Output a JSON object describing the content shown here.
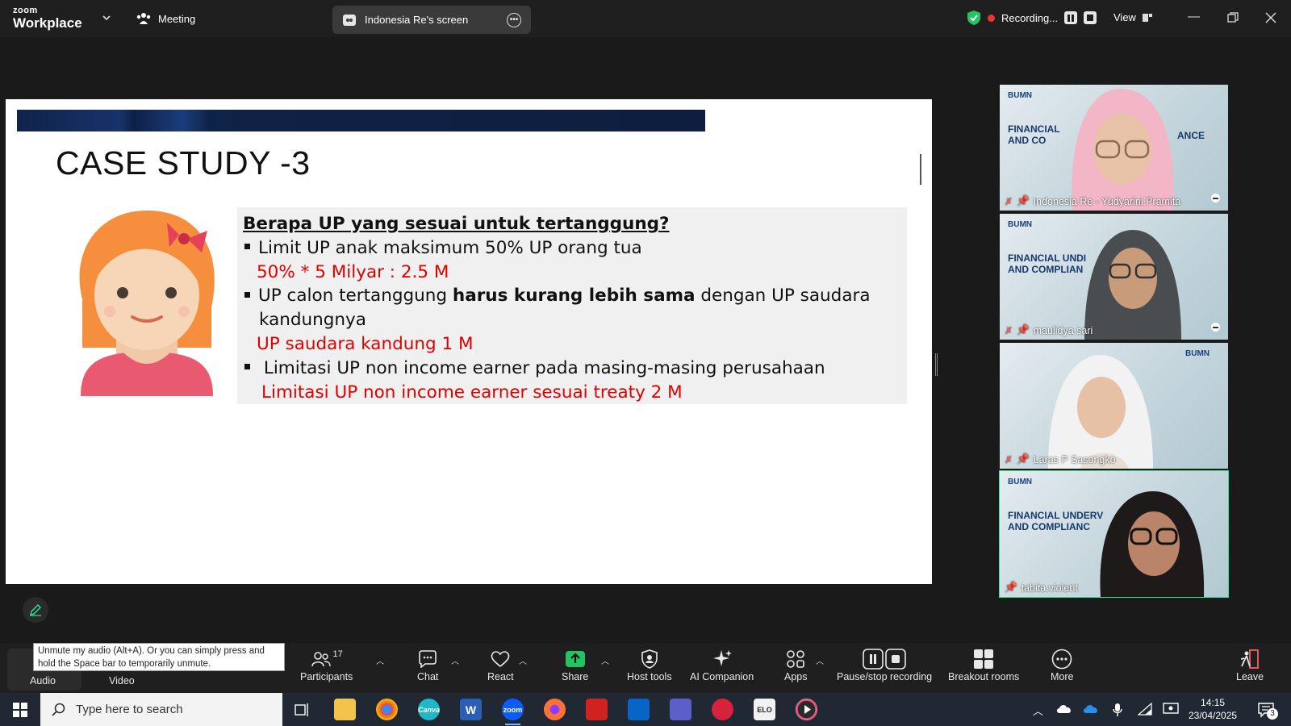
{
  "topbar": {
    "logo_small": "zoom",
    "logo_big": "Workplace",
    "meeting_label": "Meeting",
    "screen_share_label": "Indonesia Re's screen",
    "recording_label": "Recording...",
    "view_label": "View"
  },
  "slide": {
    "title": "CASE STUDY -3",
    "question": "Berapa UP yang sesuai untuk tertanggung?",
    "bullet1": "Limit UP anak maksimum 50% UP orang tua",
    "answer1": "50% * 5 Milyar : 2.5 M",
    "bullet2_pre": "UP calon tertanggung ",
    "bullet2_bold": "harus kurang lebih sama",
    "bullet2_post": " dengan UP saudara",
    "bullet2_cont": "kandungnya",
    "answer2": "UP saudara kandung 1 M",
    "bullet3": " Limitasi UP non income earner pada masing-masing perusahaan",
    "answer3": "Limitasi UP non income earner sesuai treaty 2 M"
  },
  "participants": [
    {
      "name": "Indonesia Re - Yudyarini Pramita",
      "muted": true
    },
    {
      "name": "maulidya sari",
      "muted": true
    },
    {
      "name": "Laras P Sasongko",
      "muted": true
    },
    {
      "name": "tabita.violent",
      "muted": false
    }
  ],
  "tile_texts": {
    "bumn": "BUMN",
    "banner": "FINANCIAL UNDERWRITING AND COMPLIANCE",
    "banner_short1": "FINANCIAL",
    "banner_short2": "AND CO",
    "banner_mid1": "FINANCIAL UNDI",
    "banner_mid2": "AND COMPLIAN",
    "banner_end1": "FINANCIAL UNDERV",
    "banner_end2": "AND COMPLIANC",
    "banner_ance": "ANCE"
  },
  "toolbar": {
    "tooltip": "Unmute my audio (Alt+A). Or you can simply press and hold the Space bar to temporarily unmute.",
    "audio": "Audio",
    "video": "Video",
    "participants": "Participants",
    "participants_count": "17",
    "chat": "Chat",
    "react": "React",
    "share": "Share",
    "host_tools": "Host tools",
    "ai_companion": "AI Companion",
    "apps": "Apps",
    "pause_recording": "Pause/stop recording",
    "breakout_rooms": "Breakout rooms",
    "more": "More",
    "leave": "Leave"
  },
  "taskbar": {
    "search_placeholder": "Type here to search",
    "time": "14:15",
    "date": "23/04/2025",
    "notification_count": "3",
    "canva_label": "Canva",
    "word_label": "W",
    "zoom_label": "zoom",
    "elo_label": "ELO"
  },
  "colors": {
    "accent_green": "#2ee59a",
    "recording_red": "#e33333",
    "share_green": "#22c55e",
    "slide_red": "#e00000"
  }
}
